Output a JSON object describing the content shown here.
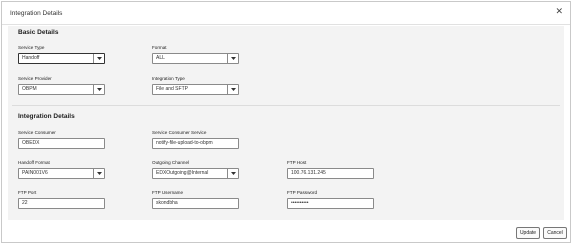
{
  "dialog": {
    "title": "Integration Details",
    "close_symbol": "✕"
  },
  "basic": {
    "title": "Basic Details",
    "service_type": {
      "label": "Service Type",
      "value": "Handoff"
    },
    "format": {
      "label": "Format",
      "value": "ALL"
    },
    "service_provider": {
      "label": "Service Provider",
      "value": "OBPM"
    },
    "integration_type": {
      "label": "Integration Type",
      "value": "File and SFTP"
    }
  },
  "integration": {
    "title": "Integration Details",
    "service_consumer": {
      "label": "Service Consumer",
      "value": "OBEDX"
    },
    "service_consumer_service": {
      "label": "Service Consumer Service",
      "value": "notify-file-upload-to-obpm"
    },
    "handoff_format": {
      "label": "Handoff Format",
      "value": "PAIN001V6"
    },
    "outgoing_channel": {
      "label": "Outgoing Channel",
      "value": "EDXOutgoing@Internal"
    },
    "ftp_host": {
      "label": "FTP Host",
      "value": "100.76.131.245"
    },
    "ftp_port": {
      "label": "FTP Port",
      "value": "22"
    },
    "ftp_username": {
      "label": "FTP Username",
      "value": "skondbha"
    },
    "ftp_password": {
      "label": "FTP Password",
      "value": "••••••••••"
    }
  },
  "footer": {
    "update_label": "Update",
    "cancel_label": "Cancel"
  }
}
